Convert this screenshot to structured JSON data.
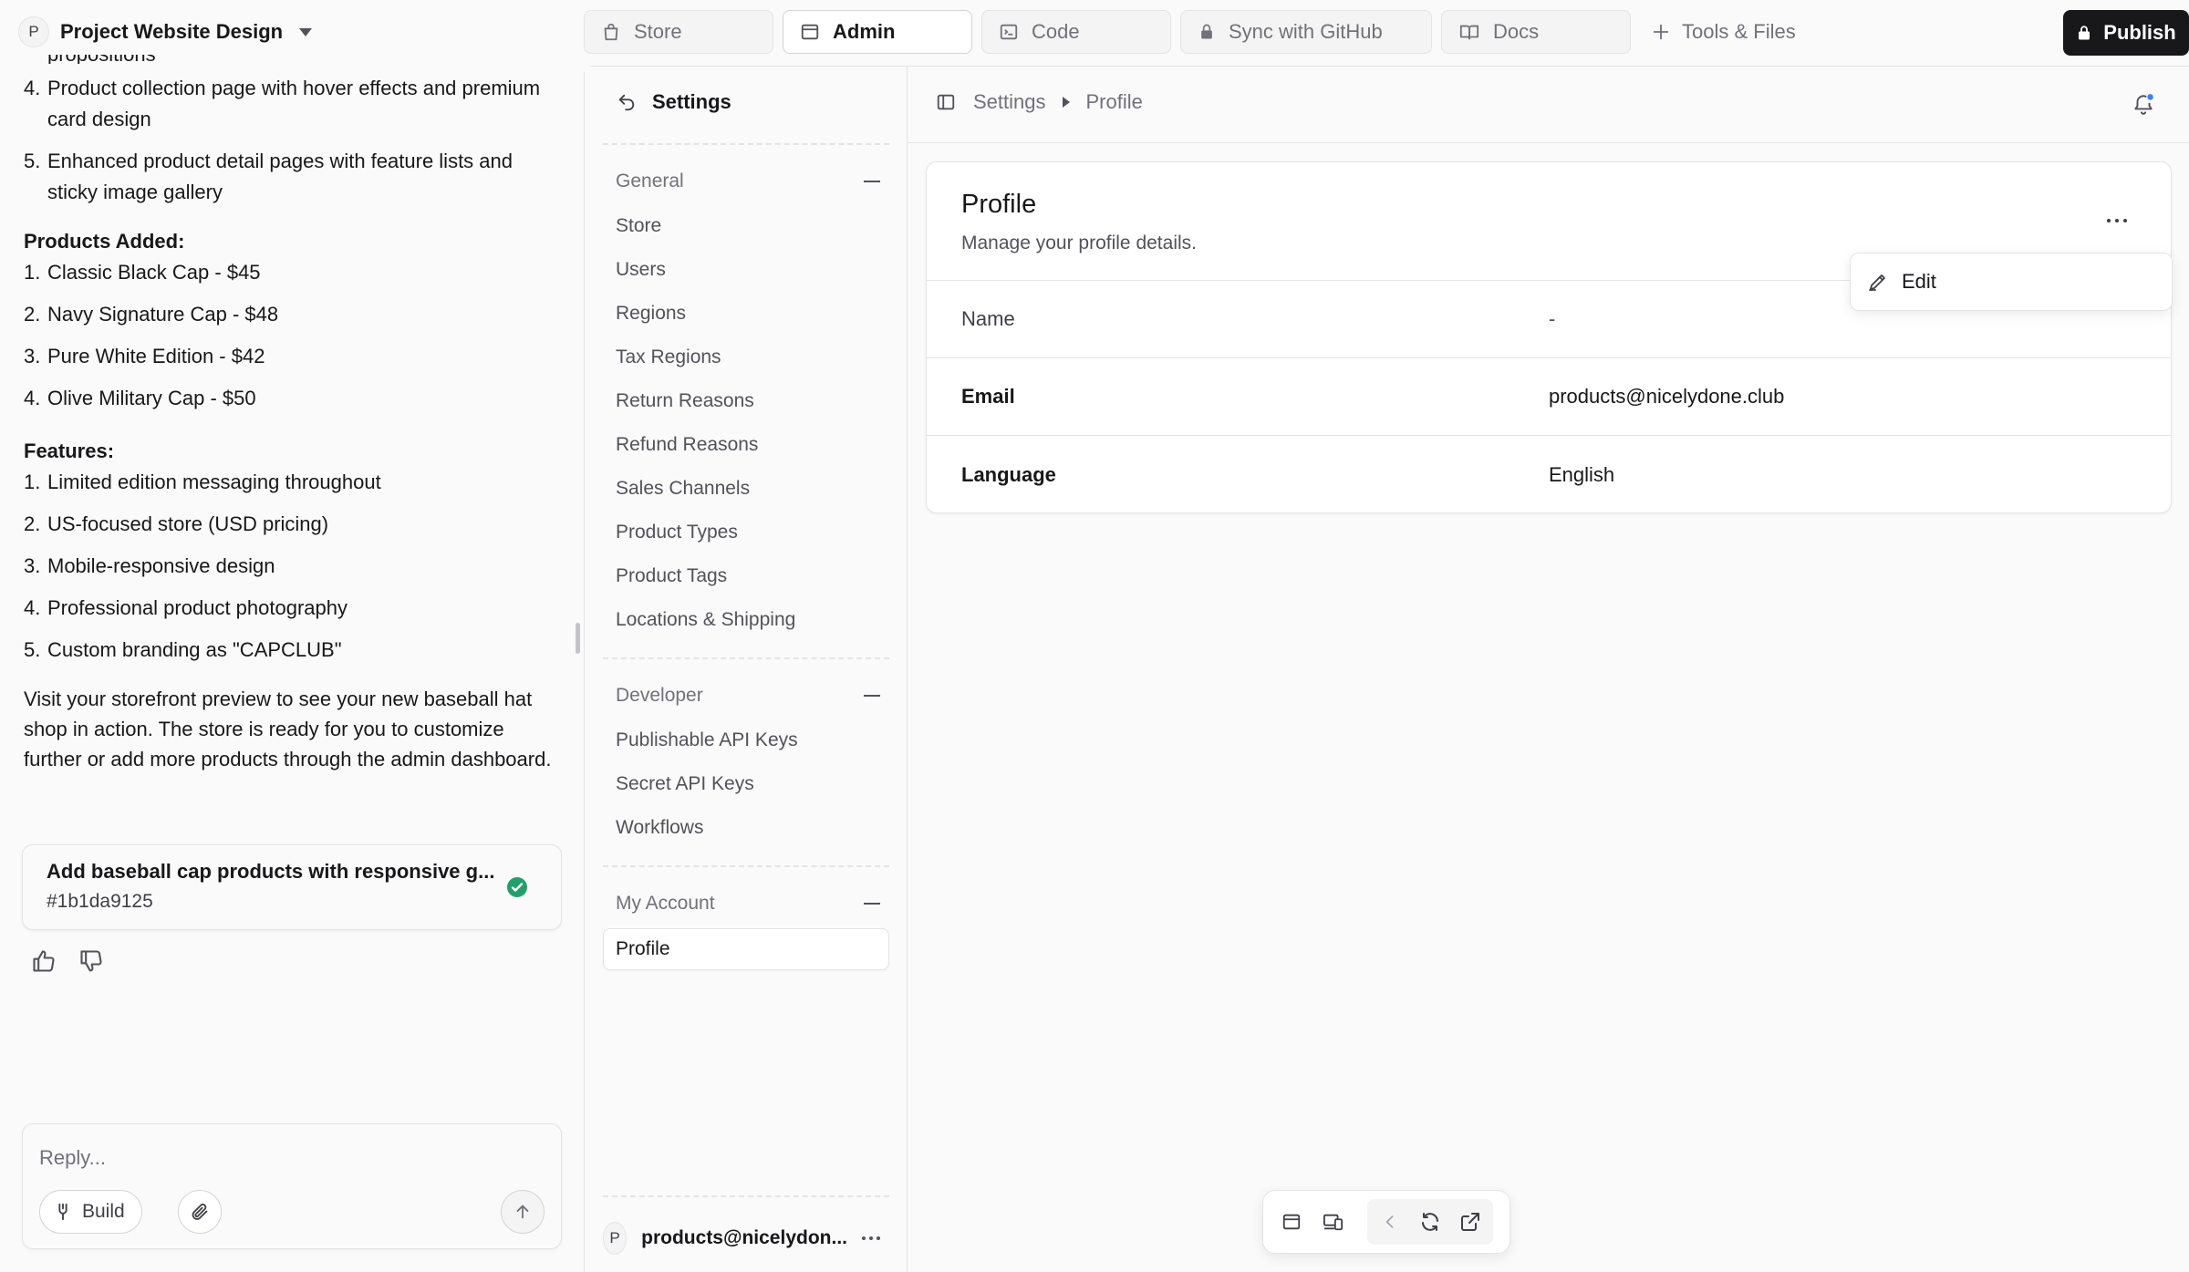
{
  "project": {
    "initial": "P",
    "name": "Project Website Design"
  },
  "chat": {
    "partial_top": "propositions",
    "intro_list": [
      {
        "num": "4.",
        "text": "Product collection page with hover effects and premium card design"
      },
      {
        "num": "5.",
        "text": "Enhanced product detail pages with feature lists and sticky image gallery"
      }
    ],
    "products_heading": "Products Added:",
    "products": [
      {
        "num": "1.",
        "text": "Classic Black Cap - $45"
      },
      {
        "num": "2.",
        "text": "Navy Signature Cap - $48"
      },
      {
        "num": "3.",
        "text": "Pure White Edition - $42"
      },
      {
        "num": "4.",
        "text": "Olive Military Cap - $50"
      }
    ],
    "features_heading": "Features:",
    "features": [
      {
        "num": "1.",
        "text": "Limited edition messaging throughout"
      },
      {
        "num": "2.",
        "text": "US-focused store (USD pricing)"
      },
      {
        "num": "3.",
        "text": "Mobile-responsive design"
      },
      {
        "num": "4.",
        "text": "Professional product photography"
      },
      {
        "num": "5.",
        "text": "Custom branding as \"CAPCLUB\""
      }
    ],
    "closing": "Visit your storefront preview to see your new baseball hat shop in action. The store is ready for you to customize further or add more products through the admin dashboard.",
    "commit": {
      "title": "Add baseball cap products with responsive g...",
      "hash": "#1b1da9125",
      "status_color": "#22a06b"
    },
    "reply_placeholder": "Reply...",
    "build_label": "Build"
  },
  "toolbar": {
    "tabs": [
      {
        "label": "Store",
        "icon": "bag-icon"
      },
      {
        "label": "Admin",
        "icon": "window-icon"
      },
      {
        "label": "Code",
        "icon": "terminal-icon"
      },
      {
        "label": "Sync with GitHub",
        "icon": "lock-icon"
      },
      {
        "label": "Docs",
        "icon": "book-icon"
      }
    ],
    "tools_label": "Tools & Files",
    "publish_label": "Publish"
  },
  "settings": {
    "title": "Settings",
    "groups": [
      {
        "title": "General",
        "items": [
          "Store",
          "Users",
          "Regions",
          "Tax Regions",
          "Return Reasons",
          "Refund Reasons",
          "Sales Channels",
          "Product Types",
          "Product Tags",
          "Locations & Shipping"
        ]
      },
      {
        "title": "Developer",
        "items": [
          "Publishable API Keys",
          "Secret API Keys",
          "Workflows"
        ]
      },
      {
        "title": "My Account",
        "items": [
          "Profile"
        ]
      }
    ],
    "account": {
      "initial": "P",
      "email": "products@nicelydon..."
    }
  },
  "breadcrumb": {
    "root": "Settings",
    "current": "Profile"
  },
  "profile": {
    "title": "Profile",
    "subtitle": "Manage your profile details.",
    "rows": [
      {
        "label": "Name",
        "value": "-"
      },
      {
        "label": "Email",
        "value": "products@nicelydone.club"
      },
      {
        "label": "Language",
        "value": "English"
      }
    ],
    "menu_edit": "Edit"
  },
  "colors": {
    "accent": "#18181b",
    "success": "#22a06b",
    "notify_dot": "#3b82f6"
  }
}
